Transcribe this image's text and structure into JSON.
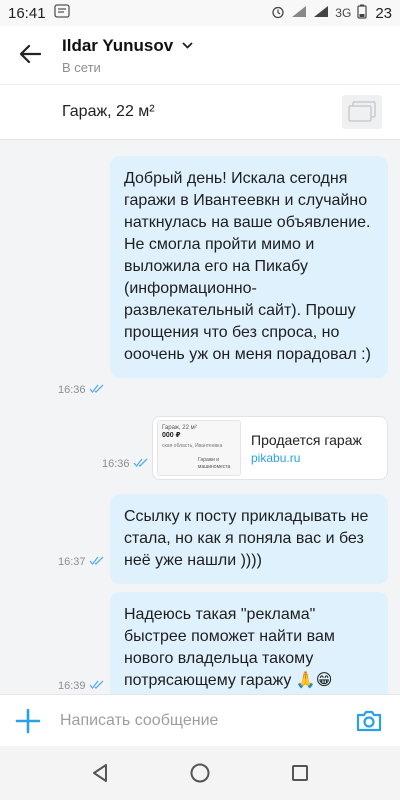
{
  "status_bar": {
    "time": "16:41",
    "network": "3G",
    "battery": "23"
  },
  "header": {
    "contact_name": "Ildar Yunusov",
    "contact_status": "В сети"
  },
  "ad": {
    "title": "Гараж, 22 м²"
  },
  "messages": [
    {
      "text": "Добрый день! Искала сегодня гаражи в Ивантеевкн и случайно наткнулась на ваше объявление. Не смогла пройти мимо и выложила его на Пикабу (информационно-развлекательный сайт). Прошу прощения что без спроса, но ооочень уж он меня порадовал :)",
      "time": "16:36"
    },
    {
      "link_title": "Продается гараж",
      "link_domain": "pikabu.ru",
      "thumb_line1": "Гараж, 22 м²",
      "thumb_price": "000 ₽",
      "thumb_region": "ская область, Ивантеевка",
      "thumb_category": "Гаражи и машиноместа",
      "time": "16:36"
    },
    {
      "text": "Ссылку к посту прикладывать не стала, но как я поняла вас и без неё уже нашли ))))",
      "time": "16:37"
    },
    {
      "text": "Надеюсь такая \"реклама\" быстрее поможет найти вам нового владельца такому потрясающему гаражу 🙏😁",
      "time": "16:39"
    }
  ],
  "input": {
    "placeholder": "Написать сообщение"
  },
  "colors": {
    "bubble": "#dff1fd",
    "accent": "#2aa0e6",
    "tick": "#5aaee6"
  }
}
